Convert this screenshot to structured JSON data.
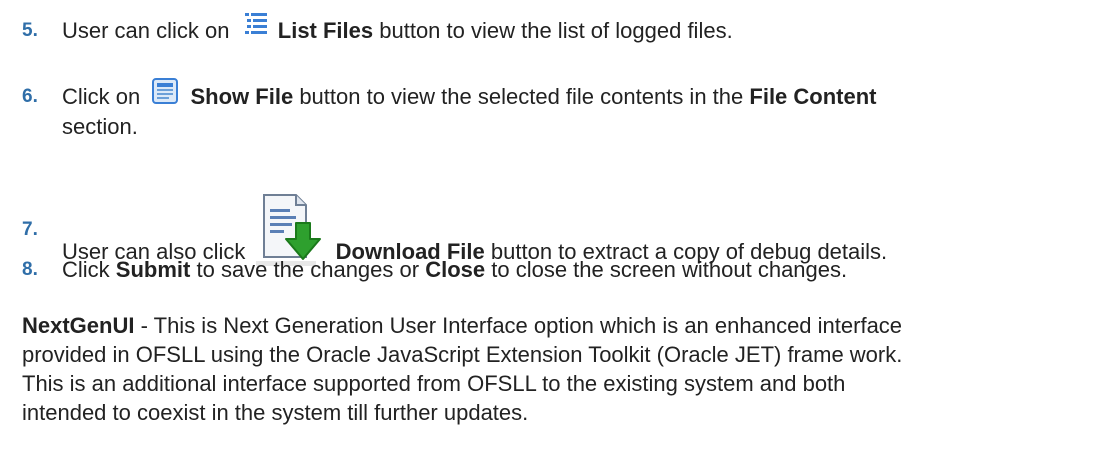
{
  "steps": [
    {
      "number": "5.",
      "before": "User can click on",
      "icon": "list-icon",
      "bold": "List Files",
      "after": "button to view the list of logged files."
    },
    {
      "number": "6.",
      "before": "Click on",
      "icon": "show-file-icon",
      "bold": "Show File",
      "middle": "button to view the selected file contents in the",
      "bold2": "File Content",
      "line2": "section."
    },
    {
      "number": "7.",
      "before": "User can also click",
      "icon": "download-file-icon",
      "bold": "Download File",
      "after": "button to extract a copy of debug details."
    },
    {
      "number": "8.",
      "before": "Click",
      "bold": "Submit",
      "middle": "to save the changes or",
      "bold2": "Close",
      "after": "to close the screen without changes."
    }
  ],
  "paragraph": {
    "lead": "NextGenUI",
    "lines": [
      " - This is Next Generation User Interface option which is an enhanced interface",
      "provided in OFSLL using the Oracle JavaScript Extension Toolkit (Oracle JET) frame work.",
      "This is an additional interface supported from OFSLL to the existing system and both",
      "intended to coexist in the system till further updates."
    ]
  },
  "colors": {
    "step_number": "#2f6ea8",
    "text": "#222222",
    "icon_blue": "#3a7fd5",
    "icon_green": "#2ea02e"
  }
}
